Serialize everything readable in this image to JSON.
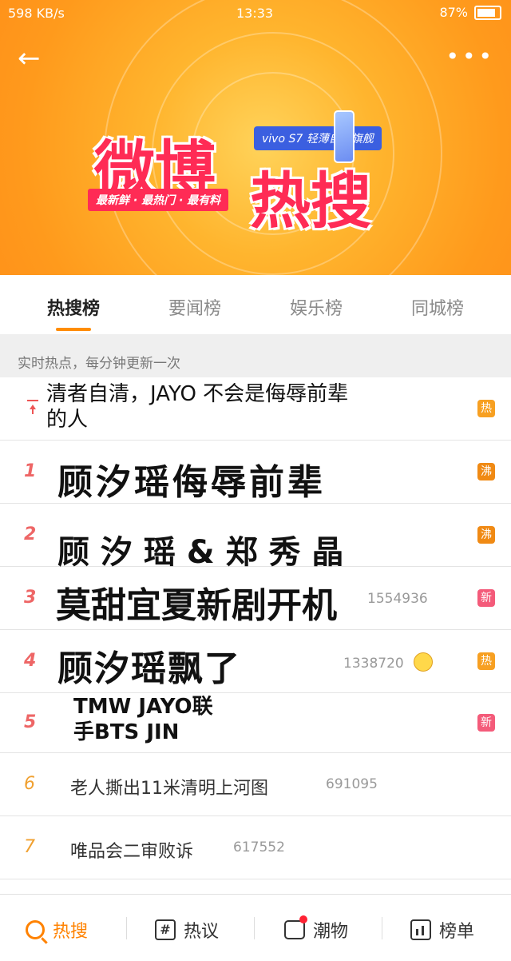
{
  "status": {
    "left": "598 KB/s",
    "time": "13:33",
    "battery": "87%"
  },
  "header": {
    "logo_text_1": "微博",
    "logo_text_2": "热搜",
    "logo_tagline": "最新鲜 · 最热门 · 最有料",
    "sponsor": "vivo S7 轻薄自拍旗舰"
  },
  "tabs": [
    {
      "label": "热搜榜",
      "active": true
    },
    {
      "label": "要闻榜",
      "active": false
    },
    {
      "label": "娱乐榜",
      "active": false
    },
    {
      "label": "同城榜",
      "active": false
    }
  ],
  "notice": "实时热点，每分钟更新一次",
  "items": [
    {
      "rank": "",
      "title": "清者自清，JAYO 不会是侮辱前辈的人",
      "title_line1": "清者自清，JAYO 不会是侮辱前辈",
      "title_line2": "的人",
      "count": "",
      "badge": "热"
    },
    {
      "rank": "1",
      "title": "顾汐瑶侮辱前辈",
      "count": "",
      "badge": "沸"
    },
    {
      "rank": "2",
      "title": "顾 汐 瑶 & 郑 秀 晶",
      "count": "",
      "badge": "沸"
    },
    {
      "rank": "3",
      "title": "莫甜宜夏新剧开机",
      "count": "1554936",
      "badge": "新"
    },
    {
      "rank": "4",
      "title": "顾汐瑶飘了",
      "count": "1338720",
      "badge": "热"
    },
    {
      "rank": "5",
      "title": "TMW JAYO联手BTS JIN",
      "title_line1": "TMW JAYO联",
      "title_line2": "手BTS JIN",
      "count": "",
      "badge": "新"
    },
    {
      "rank": "6",
      "title": "老人撕出11米清明上河图",
      "count": "691095",
      "badge": ""
    },
    {
      "rank": "7",
      "title": "唯品会二审败诉",
      "count": "617552",
      "badge": ""
    }
  ],
  "bottom_nav": [
    {
      "label": "热搜",
      "icon": "search-icon",
      "active": true
    },
    {
      "label": "热议",
      "icon": "hash-icon",
      "active": false
    },
    {
      "label": "潮物",
      "icon": "bag-icon",
      "active": false
    },
    {
      "label": "榜单",
      "icon": "chart-icon",
      "active": false
    }
  ]
}
